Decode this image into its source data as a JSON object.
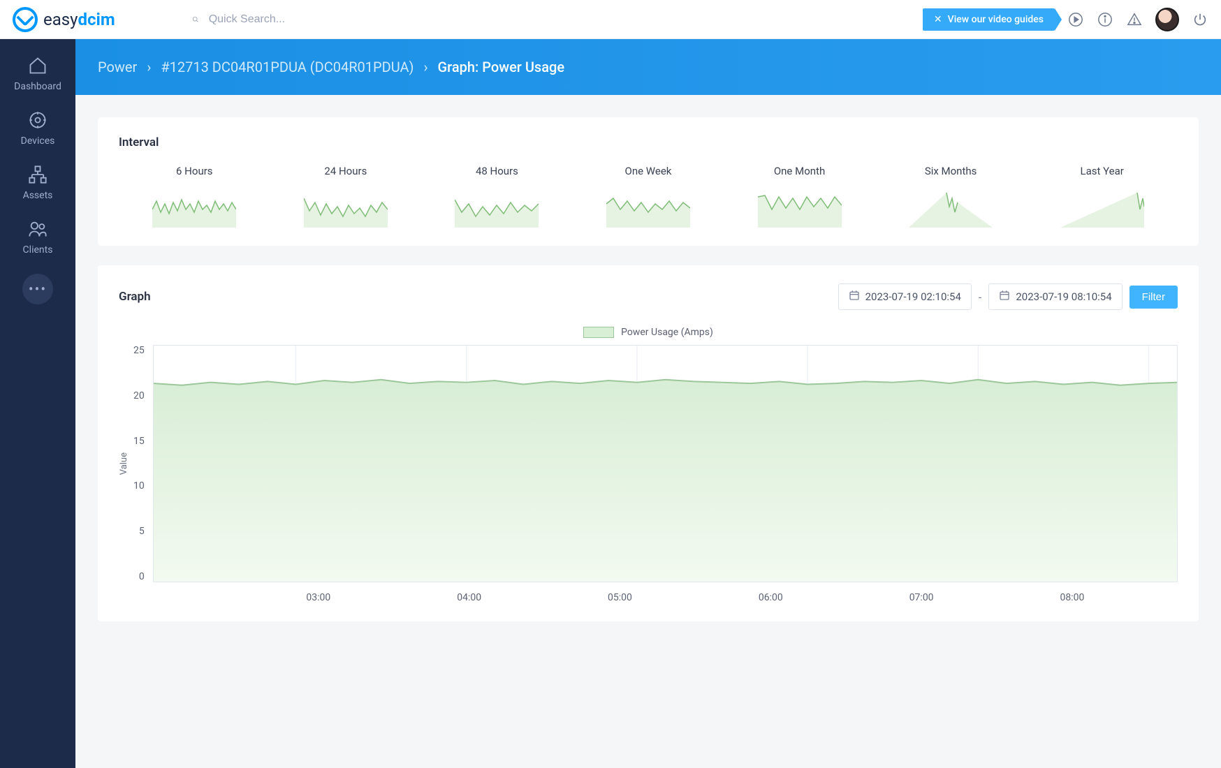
{
  "brand": {
    "name_a": "easy",
    "name_b": "dcim"
  },
  "search": {
    "placeholder": "Quick Search..."
  },
  "header": {
    "video_guide": "View our video guides"
  },
  "sidebar": {
    "items": [
      {
        "label": "Dashboard"
      },
      {
        "label": "Devices"
      },
      {
        "label": "Assets"
      },
      {
        "label": "Clients"
      }
    ]
  },
  "breadcrumb": {
    "a": "Power",
    "b": "#12713 DC04R01PDUA (DC04R01PDUA)",
    "c": "Graph: Power Usage"
  },
  "interval": {
    "title": "Interval",
    "items": [
      "6 Hours",
      "24 Hours",
      "48 Hours",
      "One Week",
      "One Month",
      "Six Months",
      "Last Year"
    ]
  },
  "graph": {
    "title": "Graph",
    "date_from": "2023-07-19 02:10:54",
    "date_to": "2023-07-19 08:10:54",
    "filter": "Filter",
    "legend": "Power Usage (Amps)",
    "ylabel": "Value"
  },
  "chart_data": {
    "type": "area",
    "title": "Power Usage (Amps)",
    "xlabel": "",
    "ylabel": "Value",
    "ylim": [
      0,
      25
    ],
    "xticks": [
      "03:00",
      "04:00",
      "05:00",
      "06:00",
      "07:00",
      "08:00"
    ],
    "yticks": [
      25,
      20,
      15,
      10,
      5,
      0
    ],
    "series": [
      {
        "name": "Power Usage (Amps)",
        "x": [
          "02:10",
          "02:20",
          "02:30",
          "02:40",
          "02:50",
          "03:00",
          "03:10",
          "03:20",
          "03:30",
          "03:40",
          "03:50",
          "04:00",
          "04:10",
          "04:20",
          "04:30",
          "04:40",
          "04:50",
          "05:00",
          "05:10",
          "05:20",
          "05:30",
          "05:40",
          "05:50",
          "06:00",
          "06:10",
          "06:20",
          "06:30",
          "06:40",
          "06:50",
          "07:00",
          "07:10",
          "07:20",
          "07:30",
          "07:40",
          "07:50",
          "08:00",
          "08:10"
        ],
        "values": [
          21.0,
          20.8,
          21.1,
          20.9,
          21.2,
          20.9,
          21.3,
          21.1,
          21.4,
          21.0,
          21.2,
          21.1,
          21.3,
          20.9,
          21.2,
          21.0,
          21.3,
          21.1,
          21.4,
          21.2,
          21.1,
          21.0,
          21.2,
          20.9,
          21.0,
          21.2,
          21.1,
          21.3,
          21.0,
          21.4,
          21.0,
          21.2,
          20.9,
          21.1,
          20.8,
          21.0,
          21.1
        ]
      }
    ]
  }
}
